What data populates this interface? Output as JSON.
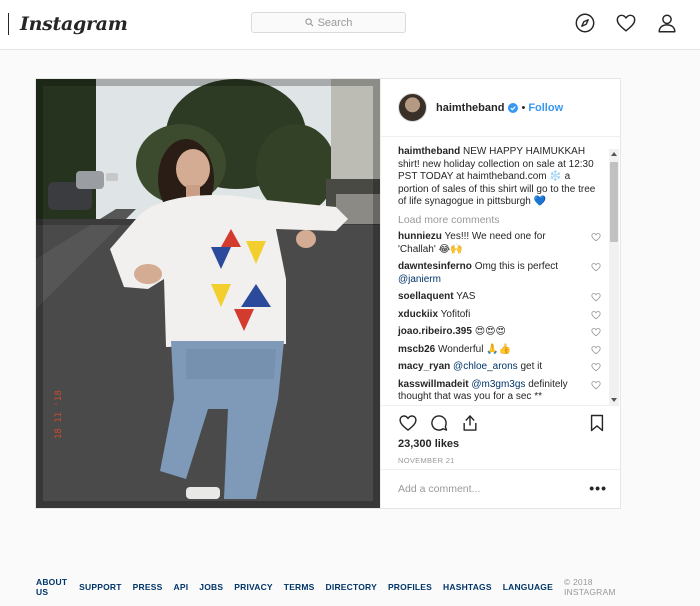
{
  "header": {
    "logo": "Instagram",
    "search_placeholder": "Search",
    "icons": [
      "compass-icon",
      "heart-icon",
      "profile-icon"
    ]
  },
  "post": {
    "author": "haimtheband",
    "follow_label": "Follow",
    "caption_user": "haimtheband",
    "caption_text": "NEW HAPPY HAIMUKKAH shirt! new holiday collection on sale at 12:30 PST TODAY at haimtheband.com ❄️ a portion of sales of this shirt will go to the tree of life synagogue in pittsburgh 💙",
    "load_more": "Load more comments",
    "comments": [
      {
        "user": "hunniezu",
        "text": "Yes!!! We need one for 'Challah' 😂🙌"
      },
      {
        "user": "dawntesinferno",
        "text": "Omg this is perfect",
        "mention": "@janierm"
      },
      {
        "user": "soellaquent",
        "text": "YAS"
      },
      {
        "user": "xduckiix",
        "text": "Yoﬁtofi"
      },
      {
        "user": "joao.ribeiro.395",
        "text": "😍😍😍"
      },
      {
        "user": "mscb26",
        "text": "Wonderful 🙏👍"
      },
      {
        "user": "macy_ryan",
        "mention": "@chloe_arons",
        "text": "get it"
      },
      {
        "user": "kasswillmadeit",
        "mention": "@m3gm3gs",
        "text": "definitely thought that was you for a sec **"
      }
    ],
    "likes": "23,300 likes",
    "date": "NOVEMBER 21",
    "add_comment_placeholder": "Add a comment...",
    "more_label": "•••",
    "photo_timestamp": "18 11 '18"
  },
  "footer": {
    "links": [
      "ABOUT US",
      "SUPPORT",
      "PRESS",
      "API",
      "JOBS",
      "PRIVACY",
      "TERMS",
      "DIRECTORY",
      "PROFILES",
      "HASHTAGS",
      "LANGUAGE"
    ],
    "copyright": "© 2018 INSTAGRAM"
  },
  "colors": {
    "link_blue": "#3897f0",
    "mention_blue": "#003569",
    "muted": "#999999",
    "border": "#efefef"
  }
}
